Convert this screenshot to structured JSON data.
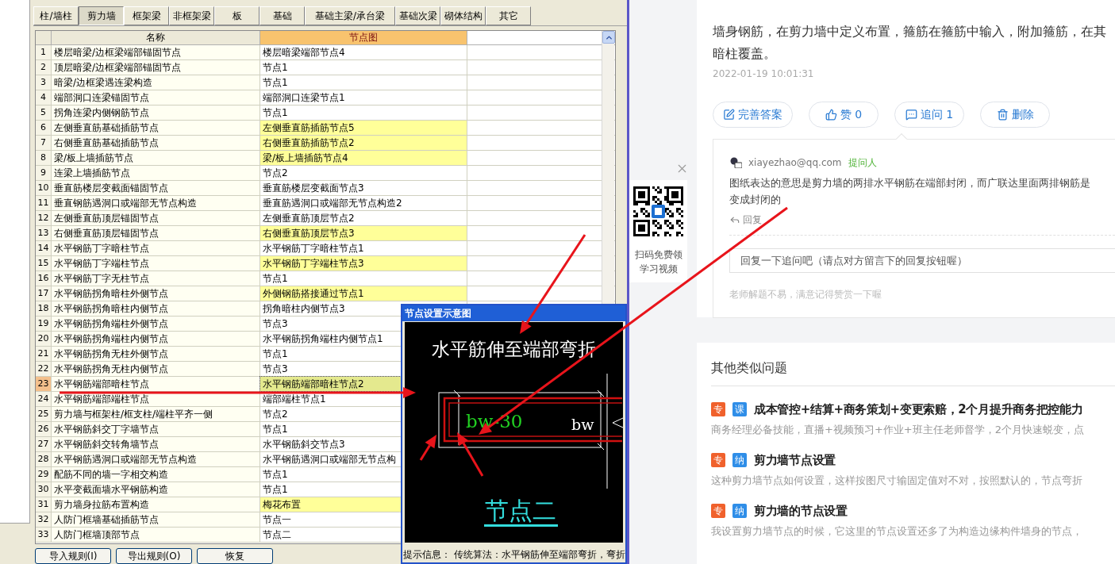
{
  "app": {
    "tabs": [
      {
        "label": "柱/墙柱",
        "selected": false
      },
      {
        "label": "剪力墙",
        "selected": true
      },
      {
        "label": "框架梁",
        "selected": false
      },
      {
        "label": "非框架梁",
        "selected": false
      },
      {
        "label": "板",
        "selected": false
      },
      {
        "label": "基础",
        "selected": false
      },
      {
        "label": "基础主梁/承台梁",
        "selected": false
      },
      {
        "label": "基础次梁",
        "selected": false
      },
      {
        "label": "砌体结构",
        "selected": false
      },
      {
        "label": "其它",
        "selected": false
      }
    ],
    "table": {
      "columns": [
        "名称",
        "节点图"
      ],
      "rows": [
        {
          "no": "1",
          "name": "楼层暗梁/边框梁端部锚固节点",
          "node": "楼层暗梁端部节点4",
          "highlighted": false,
          "selected": false
        },
        {
          "no": "2",
          "name": "顶层暗梁/边框梁端部锚固节点",
          "node": "节点1",
          "highlighted": false,
          "selected": false
        },
        {
          "no": "3",
          "name": "暗梁/边框梁遇连梁构造",
          "node": "节点1",
          "highlighted": false,
          "selected": false
        },
        {
          "no": "4",
          "name": "端部洞口连梁锚固节点",
          "node": "端部洞口连梁节点1",
          "highlighted": false,
          "selected": false
        },
        {
          "no": "5",
          "name": "拐角连梁内侧钢筋节点",
          "node": "节点1",
          "highlighted": false,
          "selected": false
        },
        {
          "no": "6",
          "name": "左侧垂直筋基础插筋节点",
          "node": "左侧垂直筋插筋节点5",
          "highlighted": true,
          "selected": false
        },
        {
          "no": "7",
          "name": "右侧垂直筋基础插筋节点",
          "node": "右侧垂直筋插筋节点2",
          "highlighted": true,
          "selected": false
        },
        {
          "no": "8",
          "name": "梁/板上墙插筋节点",
          "node": "梁/板上墙插筋节点4",
          "highlighted": true,
          "selected": false
        },
        {
          "no": "9",
          "name": "连梁上墙插筋节点",
          "node": "节点2",
          "highlighted": false,
          "selected": false
        },
        {
          "no": "10",
          "name": "垂直筋楼层变截面锚固节点",
          "node": "垂直筋楼层变截面节点3",
          "highlighted": false,
          "selected": false
        },
        {
          "no": "11",
          "name": "垂直钢筋遇洞口或端部无节点构造",
          "node": "垂直筋遇洞口或端部无节点构造2",
          "highlighted": false,
          "selected": false
        },
        {
          "no": "12",
          "name": "左侧垂直筋顶层锚固节点",
          "node": "左侧垂直筋顶层节点2",
          "highlighted": false,
          "selected": false
        },
        {
          "no": "13",
          "name": "右侧垂直筋顶层锚固节点",
          "node": "右侧垂直筋顶层节点3",
          "highlighted": true,
          "selected": false
        },
        {
          "no": "14",
          "name": "水平钢筋丁字暗柱节点",
          "node": "水平钢筋丁字暗柱节点1",
          "highlighted": false,
          "selected": false
        },
        {
          "no": "15",
          "name": "水平钢筋丁字端柱节点",
          "node": "水平钢筋丁字端柱节点3",
          "highlighted": true,
          "selected": false
        },
        {
          "no": "16",
          "name": "水平钢筋丁字无柱节点",
          "node": "节点1",
          "highlighted": false,
          "selected": false
        },
        {
          "no": "17",
          "name": "水平钢筋拐角暗柱外侧节点",
          "node": "外侧钢筋搭接通过节点1",
          "highlighted": true,
          "selected": false
        },
        {
          "no": "18",
          "name": "水平钢筋拐角暗柱内侧节点",
          "node": "拐角暗柱内侧节点3",
          "highlighted": false,
          "selected": false
        },
        {
          "no": "19",
          "name": "水平钢筋拐角端柱外侧节点",
          "node": "节点3",
          "highlighted": false,
          "selected": false
        },
        {
          "no": "20",
          "name": "水平钢筋拐角端柱内侧节点",
          "node": "水平钢筋拐角端柱内侧节点1",
          "highlighted": false,
          "selected": false
        },
        {
          "no": "21",
          "name": "水平钢筋拐角无柱外侧节点",
          "node": "节点1",
          "highlighted": false,
          "selected": false
        },
        {
          "no": "22",
          "name": "水平钢筋拐角无柱内侧节点",
          "node": "节点3",
          "highlighted": false,
          "selected": false
        },
        {
          "no": "23",
          "name": "水平钢筋端部暗柱节点",
          "node": "水平钢筋端部暗柱节点2",
          "highlighted": false,
          "selected": true
        },
        {
          "no": "24",
          "name": "水平钢筋端部端柱节点",
          "node": "端部端柱节点1",
          "highlighted": false,
          "selected": false
        },
        {
          "no": "25",
          "name": "剪力墙与框架柱/框支柱/端柱平齐一侧",
          "node": "节点2",
          "highlighted": false,
          "selected": false
        },
        {
          "no": "26",
          "name": "水平钢筋斜交丁字墙节点",
          "node": "节点1",
          "highlighted": false,
          "selected": false
        },
        {
          "no": "27",
          "name": "水平钢筋斜交转角墙节点",
          "node": "水平钢筋斜交节点3",
          "highlighted": false,
          "selected": false
        },
        {
          "no": "28",
          "name": "水平钢筋遇洞口或端部无节点构造",
          "node": "水平钢筋遇洞口或端部无节点构",
          "highlighted": false,
          "selected": false
        },
        {
          "no": "29",
          "name": "配筋不同的墙一字相交构造",
          "node": "节点1",
          "highlighted": false,
          "selected": false
        },
        {
          "no": "30",
          "name": "水平变截面墙水平钢筋构造",
          "node": "节点1",
          "highlighted": false,
          "selected": false
        },
        {
          "no": "31",
          "name": "剪力墙身拉筋布置构造",
          "node": "梅花布置",
          "highlighted": true,
          "selected": false
        },
        {
          "no": "32",
          "name": "人防门框墙基础插筋节点",
          "node": "节点一",
          "highlighted": false,
          "selected": false
        },
        {
          "no": "33",
          "name": "人防门框墙顶部节点",
          "node": "节点二",
          "highlighted": false,
          "selected": false
        }
      ]
    },
    "buttons": [
      "导入规则(I)",
      "导出规则(O)",
      "恢复"
    ],
    "preview": {
      "title": "节点设置示意图",
      "heading": "水平筋伸至端部弯折",
      "dim_label": "bw-30",
      "width_label": "bw",
      "caption": "节点二",
      "hint": "提示信息： 传统算法：水平钢筋伸至端部弯折，弯折"
    }
  },
  "browser": {
    "qr_promo": {
      "text_lines": [
        "扫码免费领",
        "学习视频"
      ]
    },
    "answer": {
      "lines": [
        "墙身钢筋，在剪力墙中定义布置，箍筋在箍筋中输入，附加箍筋，在其",
        "暗柱覆盖。"
      ],
      "time": "2022-01-19 10:01:31",
      "actions": [
        {
          "kind": "edit",
          "label": "完善答案"
        },
        {
          "kind": "like",
          "label": "赞 0"
        },
        {
          "kind": "ask",
          "label": "追问 1"
        },
        {
          "kind": "delete",
          "label": "删除"
        }
      ]
    },
    "follow_up": {
      "user": "xiayezhao@qq.com",
      "role": "提问人",
      "lines": [
        "图纸表达的意思是剪力墙的两排水平钢筋在端部封闭，而广联达里面两排钢筋是",
        "变成封闭的"
      ],
      "reply": "回复",
      "placeholder": "回复一下追问吧（请点对方留言下的回复按钮喔）",
      "tip": "老师解题不易，满意记得赞赏一下喔"
    },
    "similar": {
      "title": "其他类似问题",
      "items": [
        {
          "tags": [
            {
              "label": "专",
              "color": "#f0612c"
            },
            {
              "label": "课",
              "color": "#2f8ee8"
            }
          ],
          "title": "成本管控+结算+商务策划+变更索赔，2个月提升商务把控能力",
          "desc": "商务经理必备技能，直播+视频预习+作业+班主任老师督学，2个月快速蜕变，点"
        },
        {
          "tags": [
            {
              "label": "专",
              "color": "#f0612c"
            },
            {
              "label": "纳",
              "color": "#2f8ee8"
            }
          ],
          "title": "剪力墙节点设置",
          "desc": "这种剪力墙节点如何设置，这样按图尺寸输固定值对不对，按照默认的，节点弯折"
        },
        {
          "tags": [
            {
              "label": "专",
              "color": "#f0612c"
            },
            {
              "label": "纳",
              "color": "#2f8ee8"
            }
          ],
          "title": "剪力墙的节点设置",
          "desc": "我设置剪力墙节点的时候，它这里的节点设置还多了为构造边缘构件墙身的节点，"
        }
      ]
    }
  }
}
